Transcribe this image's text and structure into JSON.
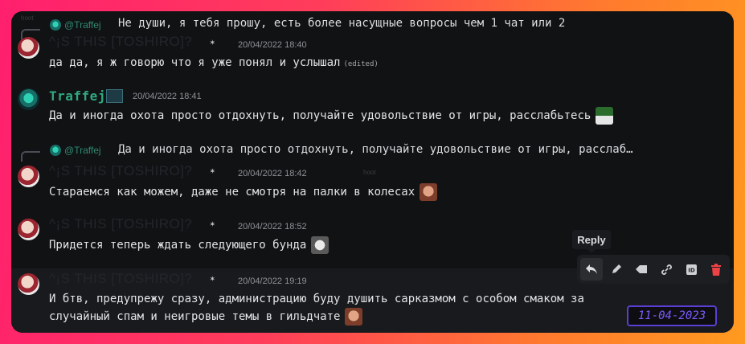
{
  "messages": [
    {
      "reply": {
        "name": "@Traffej",
        "text": "Не души, я тебя прошу, есть более насущные вопросы чем 1 чат или 2"
      },
      "author": "^¡S THIS [TOSHIRO]?",
      "timestamp": "20/04/2022 18:40",
      "text": "да да, я ж говорю что я уже понял и услышал",
      "edited": "(edited)"
    },
    {
      "author": "Traffej",
      "timestamp": "20/04/2022 18:41",
      "text": "Да и иногда охота просто отдохнуть, получайте удовольствие от игры, расслабьтесь"
    },
    {
      "reply": {
        "name": "@Traffej",
        "text": "Да и иногда охота просто отдохнуть, получайте удовольствие от игры, расслаб…"
      },
      "author": "^¡S THIS [TOSHIRO]?",
      "timestamp": "20/04/2022 18:42",
      "text": "Стараемся как можем, даже не смотря на палки в колесах"
    },
    {
      "author": "^¡S THIS [TOSHIRO]?",
      "timestamp": "20/04/2022 18:52",
      "text": "Придется теперь ждать следующего бунда"
    },
    {
      "author": "^¡S THIS [TOSHIRO]?",
      "timestamp": "20/04/2022 19:19",
      "text_line1": "И бтв, предупрежу сразу, администрацию буду душить сарказмом с особом смаком за",
      "text_line2": "случайный спам и неигровые темы в гильдчате"
    }
  ],
  "toolbar": {
    "tooltip": "Reply",
    "actions": [
      "reply-icon",
      "edit-icon",
      "tag-icon",
      "link-icon",
      "id-icon",
      "trash-icon"
    ]
  },
  "watermark": "11-04-2023",
  "faint_labels": [
    "hoot",
    "hoot"
  ],
  "colors": {
    "green_name": "#2fa982",
    "danger": "#ed4245",
    "stamp": "#7c5cff"
  }
}
